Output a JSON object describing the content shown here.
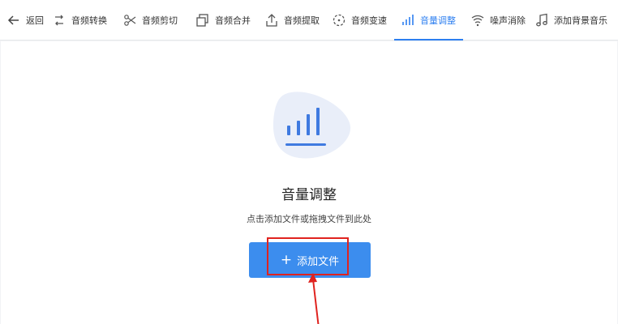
{
  "toolbar": {
    "items": [
      {
        "label": "返回",
        "icon": "back-arrow-icon"
      },
      {
        "label": "音频转换",
        "icon": "convert-icon"
      },
      {
        "label": "音频剪切",
        "icon": "scissors-icon"
      },
      {
        "label": "音频合并",
        "icon": "merge-icon"
      },
      {
        "label": "音频提取",
        "icon": "extract-icon"
      },
      {
        "label": "音频变速",
        "icon": "speed-icon"
      },
      {
        "label": "音量调整",
        "icon": "volume-bars-icon",
        "active": true
      },
      {
        "label": "噪声消除",
        "icon": "noise-icon"
      },
      {
        "label": "添加背景音乐",
        "icon": "music-note-icon"
      }
    ]
  },
  "main": {
    "title": "音量调整",
    "subtitle": "点击添加文件或拖拽文件到此处",
    "add_button": {
      "label": "添加文件",
      "icon": "plus-icon"
    }
  },
  "colors": {
    "accent": "#2d7ff0",
    "button": "#3c8dee",
    "highlight": "#e0231f",
    "hero_blob": "#e9eef9"
  }
}
